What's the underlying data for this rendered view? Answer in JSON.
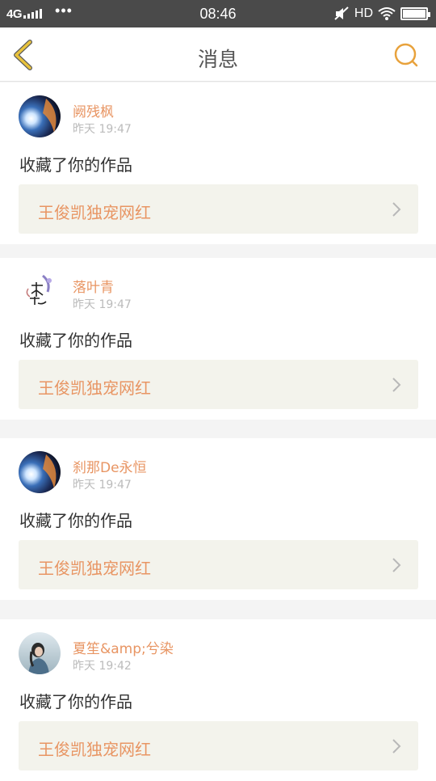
{
  "status_bar": {
    "network": "4G",
    "dots": "•••",
    "time": "08:46",
    "hd": "HD"
  },
  "nav": {
    "title": "消息",
    "back_icon": "chevron-left-icon",
    "search_icon": "search-icon",
    "accent_color": "#e8a23c"
  },
  "messages": [
    {
      "username": "阙残枫",
      "time": "昨天 19:47",
      "action": "收藏了你的作品",
      "work_title": "王俊凯独宠网红"
    },
    {
      "username": "落叶青",
      "time": "昨天 19:47",
      "action": "收藏了你的作品",
      "work_title": "王俊凯独宠网红"
    },
    {
      "username": "刹那De永恒",
      "time": "昨天 19:47",
      "action": "收藏了你的作品",
      "work_title": "王俊凯独宠网红"
    },
    {
      "username": "夏笙&amp;兮染",
      "time": "昨天 19:42",
      "action": "收藏了你的作品",
      "work_title": "王俊凯独宠网红"
    }
  ],
  "colors": {
    "username": "#e89563",
    "link_background": "#f3f3ec",
    "page_background": "#f4f4f4"
  }
}
